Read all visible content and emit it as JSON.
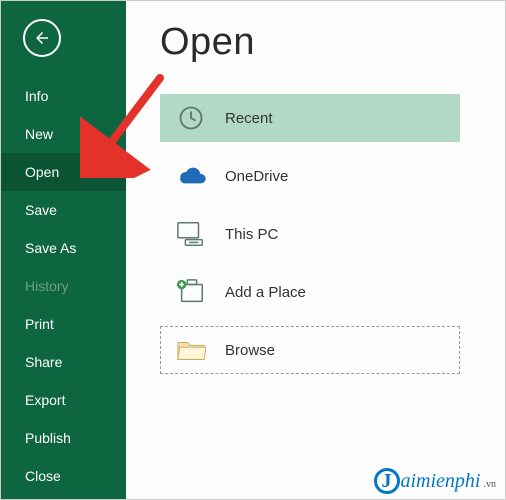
{
  "sidebar": {
    "items": [
      {
        "label": "Info",
        "selected": false,
        "disabled": false
      },
      {
        "label": "New",
        "selected": false,
        "disabled": false
      },
      {
        "label": "Open",
        "selected": true,
        "disabled": false
      },
      {
        "label": "Save",
        "selected": false,
        "disabled": false
      },
      {
        "label": "Save As",
        "selected": false,
        "disabled": false
      },
      {
        "label": "History",
        "selected": false,
        "disabled": true
      },
      {
        "label": "Print",
        "selected": false,
        "disabled": false
      },
      {
        "label": "Share",
        "selected": false,
        "disabled": false
      },
      {
        "label": "Export",
        "selected": false,
        "disabled": false
      },
      {
        "label": "Publish",
        "selected": false,
        "disabled": false
      },
      {
        "label": "Close",
        "selected": false,
        "disabled": false
      }
    ]
  },
  "main": {
    "title": "Open",
    "options": [
      {
        "label": "Recent",
        "icon": "clock-icon",
        "highlight": true,
        "outlined": false
      },
      {
        "label": "OneDrive",
        "icon": "cloud-icon",
        "highlight": false,
        "outlined": false
      },
      {
        "label": "This PC",
        "icon": "monitor-icon",
        "highlight": false,
        "outlined": false
      },
      {
        "label": "Add a Place",
        "icon": "add-place-icon",
        "highlight": false,
        "outlined": false
      },
      {
        "label": "Browse",
        "icon": "folder-icon",
        "highlight": false,
        "outlined": true
      }
    ]
  },
  "watermark": {
    "letter": "J",
    "text": "aimienphi",
    "ext": ".vn"
  },
  "colors": {
    "brand": "#0d6640",
    "brand_dark": "#0a5434",
    "accent_green": "#b2d9c6",
    "cloud_blue": "#1f6bb7",
    "watermark_blue": "#0077c8",
    "arrow_red": "#e4322b"
  }
}
